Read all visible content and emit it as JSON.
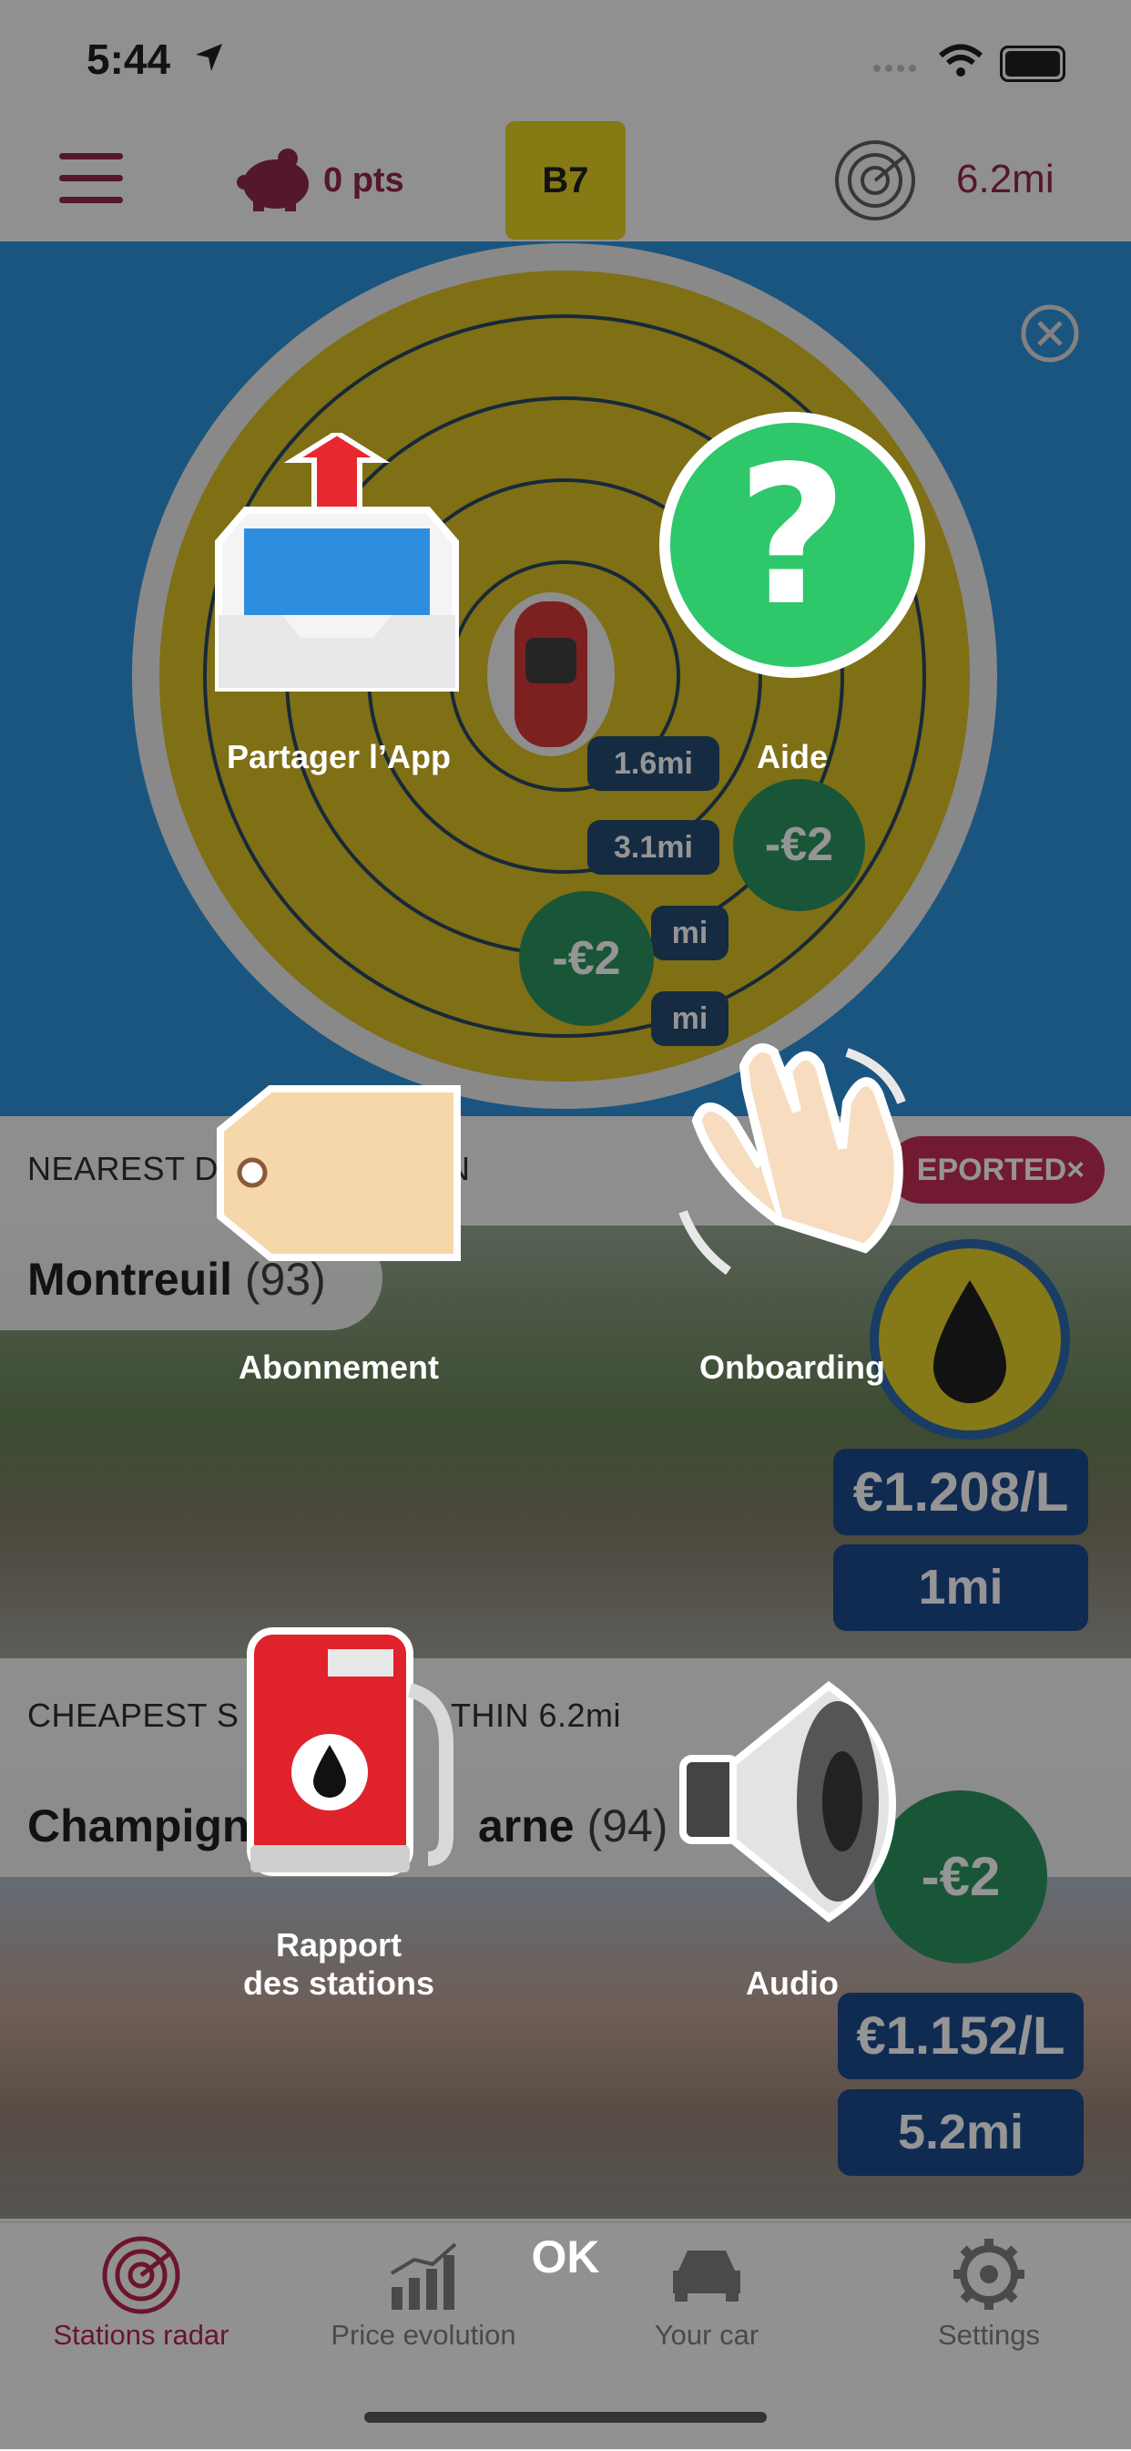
{
  "status_bar": {
    "time": "5:44"
  },
  "header": {
    "points": "0 pts",
    "fuel_type": "B7",
    "radius": "6.2mi"
  },
  "radar": {
    "rings": [
      "1.6mi",
      "3.1mi",
      "mi",
      "mi"
    ],
    "discounts": [
      "-€2",
      "-€2"
    ]
  },
  "nearest": {
    "label": "NEAREST D",
    "label_end": "N",
    "reported_badge": "EPORTED×",
    "city": "Montreuil",
    "dept": "(93)",
    "price": "€1.208/L",
    "distance": "1mi"
  },
  "cheapest": {
    "label": "CHEAPEST S",
    "label_end": "THIN 6.2mi",
    "city_start": "Champign",
    "city_end": "arne",
    "dept": "(94)",
    "discount": "-€2",
    "price": "€1.152/L",
    "distance": "5.2mi"
  },
  "tabs": [
    {
      "label": "Stations radar",
      "color": "#b3173f"
    },
    {
      "label": "Price evolution",
      "color": "#777777"
    },
    {
      "label": "Your car",
      "color": "#777777"
    },
    {
      "label": "Settings",
      "color": "#777777"
    }
  ],
  "menu": {
    "share": "Partager l’App",
    "help": "Aide",
    "subscription": "Abonnement",
    "onboarding": "Onboarding",
    "station_report_line1": "Rapport",
    "station_report_line2": "des stations",
    "audio": "Audio",
    "ok": "OK"
  },
  "colors": {
    "accent": "#8b1b3f",
    "radar_blue": "#1f8ad8",
    "radar_yellow": "#d8bb17",
    "help_green": "#2ec76a"
  }
}
